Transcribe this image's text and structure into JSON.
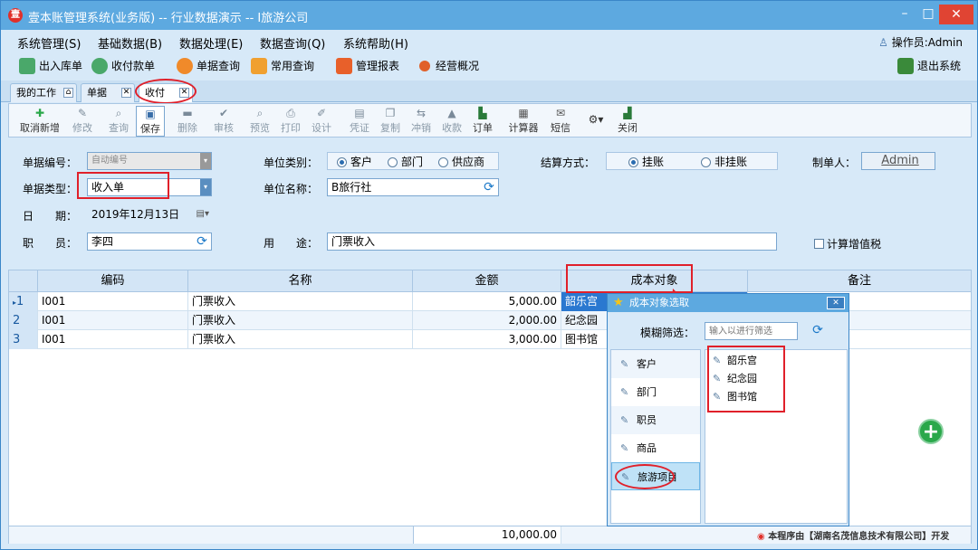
{
  "window": {
    "title": "壹本账管理系统(业务版) -- 行业数据演示 -- I旅游公司",
    "app_icon_glyph": "壹",
    "min_glyph": "–",
    "max_glyph": "□",
    "close_glyph": "✕"
  },
  "menu": {
    "items": [
      "系统管理(S)",
      "基础数据(B)",
      "数据处理(E)",
      "数据查询(Q)",
      "系统帮助(H)"
    ],
    "operator": "操作员:Admin"
  },
  "quickbar": {
    "items": [
      "出入库单",
      "收付款单",
      "单据查询",
      "常用查询",
      "管理报表",
      "经营概况"
    ],
    "exit": "退出系统"
  },
  "tabs": {
    "items": [
      "我的工作台",
      "单据查询",
      "收付款单"
    ],
    "active": "收付款单"
  },
  "toolbar": {
    "buttons": [
      "取消新增",
      "修改",
      "查询",
      "保存",
      "删除",
      "审核",
      "预览",
      "打印",
      "设计",
      "凭证",
      "复制",
      "冲销",
      "收款",
      "订单",
      "计算器",
      "短信",
      "关闭"
    ]
  },
  "form": {
    "doc_no_label": "单据编号：",
    "doc_no_value": "自动编号",
    "doc_type_label": "单据类型：",
    "doc_type_value": "收入单",
    "date_label": "日　　期：",
    "date_value": "2019年12月13日",
    "staff_label": "职　　员：",
    "staff_value": "李四",
    "unit_type_label": "单位类别：",
    "unit_type_options": [
      "客户",
      "部门",
      "供应商"
    ],
    "unit_type_selected": "客户",
    "unit_name_label": "单位名称：",
    "unit_name_value": "B旅行社",
    "purpose_label": "用　　途：",
    "purpose_value": "门票收入",
    "settle_label": "结算方式：",
    "settle_options": [
      "挂账",
      "非挂账"
    ],
    "settle_selected": "挂账",
    "maker_label": "制单人：",
    "maker_value": "Admin",
    "vat_label": "计算增值税"
  },
  "grid": {
    "columns": [
      "编码",
      "名称",
      "金额",
      "成本对象",
      "备注"
    ],
    "rows": [
      {
        "no": "1",
        "code": "I001",
        "name": "门票收入",
        "amount": "5,000.00",
        "cost_object": "韶乐宫",
        "note": ""
      },
      {
        "no": "2",
        "code": "I001",
        "name": "门票收入",
        "amount": "2,000.00",
        "cost_object": "纪念园",
        "note": ""
      },
      {
        "no": "3",
        "code": "I001",
        "name": "门票收入",
        "amount": "3,000.00",
        "cost_object": "图书馆",
        "note": ""
      }
    ],
    "total": "10,000.00"
  },
  "popup": {
    "title": "成本对象选取",
    "filter_label": "模糊筛选：",
    "filter_placeholder": "输入以进行筛选",
    "categories": [
      "客户",
      "部门",
      "职员",
      "商品",
      "旅游项目"
    ],
    "selected_category": "旅游项目",
    "tree_items": [
      "韶乐宫",
      "纪念园",
      "图书馆"
    ]
  },
  "brand": "本程序由【湖南名茂信息技术有限公司】开发",
  "colors": {
    "titlebar": "#5da9e0",
    "background": "#d7e9f8",
    "highlight_red": "#e0202a",
    "add_green": "#2aa84a"
  }
}
